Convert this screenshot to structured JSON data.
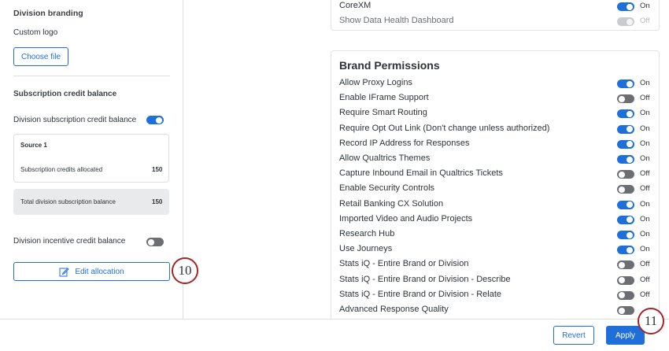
{
  "left": {
    "division_branding_title": "Division branding",
    "custom_logo_label": "Custom logo",
    "choose_file_label": "Choose file",
    "subscription_title": "Subscription credit balance",
    "division_subscription_label": "Division subscription credit balance",
    "division_subscription_state": "on",
    "source": {
      "title": "Source 1",
      "allocated_label": "Subscription credits allocated",
      "allocated_value": "150"
    },
    "total": {
      "label": "Total division subscription balance",
      "value": "150"
    },
    "incentive_label": "Division incentive credit balance",
    "incentive_state": "off",
    "edit_allocation_label": "Edit allocation",
    "edit_icon": "edit-pencil-icon"
  },
  "top_card": {
    "rows": [
      {
        "label": "CoreXM",
        "state": "On",
        "on": true,
        "disabled": false
      },
      {
        "label": "Show Data Health Dashboard",
        "state": "Off",
        "on": false,
        "disabled": true
      }
    ]
  },
  "brand_permissions": {
    "title": "Brand Permissions",
    "rows": [
      {
        "label": "Allow Proxy Logins",
        "state": "On",
        "on": true
      },
      {
        "label": "Enable IFrame Support",
        "state": "Off",
        "on": false
      },
      {
        "label": "Require Smart Routing",
        "state": "On",
        "on": true
      },
      {
        "label": "Require Opt Out Link (Don't change unless authorized)",
        "state": "On",
        "on": true
      },
      {
        "label": "Record IP Address for Responses",
        "state": "On",
        "on": true
      },
      {
        "label": "Allow Qualtrics Themes",
        "state": "On",
        "on": true
      },
      {
        "label": "Capture Inbound Email in Qualtrics Tickets",
        "state": "Off",
        "on": false
      },
      {
        "label": "Enable Security Controls",
        "state": "Off",
        "on": false
      },
      {
        "label": "Retail Banking CX Solution",
        "state": "On",
        "on": true
      },
      {
        "label": "Imported Video and Audio Projects",
        "state": "On",
        "on": true
      },
      {
        "label": "Research Hub",
        "state": "On",
        "on": true
      },
      {
        "label": "Use Journeys",
        "state": "On",
        "on": true
      },
      {
        "label": "Stats iQ - Entire Brand or Division",
        "state": "Off",
        "on": false
      },
      {
        "label": "Stats iQ - Entire Brand or Division - Describe",
        "state": "Off",
        "on": false
      },
      {
        "label": "Stats iQ - Entire Brand or Division - Relate",
        "state": "Off",
        "on": false
      },
      {
        "label": "Advanced Response Quality",
        "state": "",
        "on": false
      }
    ]
  },
  "footer": {
    "revert_label": "Revert",
    "apply_label": "Apply"
  },
  "callouts": {
    "edit_step": "10",
    "apply_step": "11"
  },
  "colors": {
    "accent": "#1f6fdb",
    "toggle_off": "#6b6f73",
    "callout_ring": "#a2252a"
  }
}
